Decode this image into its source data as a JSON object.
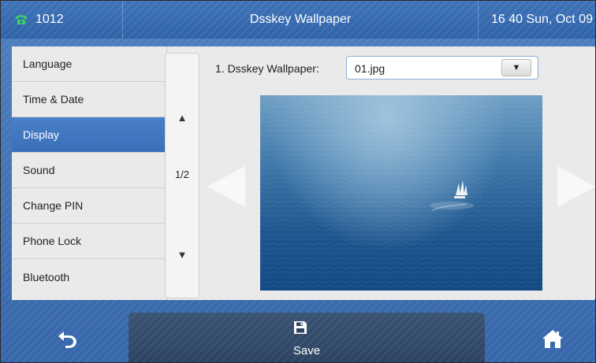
{
  "titlebar": {
    "account": "1012",
    "title": "Dsskey Wallpaper",
    "clock": "16 40 Sun, Oct 09"
  },
  "menu": {
    "items": [
      {
        "label": "Language"
      },
      {
        "label": "Time & Date"
      },
      {
        "label": "Display",
        "active": true
      },
      {
        "label": "Sound"
      },
      {
        "label": "Change PIN"
      },
      {
        "label": "Phone Lock"
      },
      {
        "label": "Bluetooth"
      }
    ],
    "page_indicator": "1/2"
  },
  "setting": {
    "label": "1. Dsskey Wallpaper:",
    "value": "01.jpg"
  },
  "softkeys": {
    "save_label": "Save"
  },
  "icons": {
    "account": "phone-icon",
    "back": "back-arrow-icon",
    "save": "floppy-disk-icon",
    "home": "home-icon",
    "scroll_up": "triangle-up-icon",
    "scroll_down": "triangle-down-icon",
    "dropdown": "triangle-down-icon",
    "prev": "triangle-left-icon",
    "next": "triangle-right-icon"
  },
  "colors": {
    "accent": "#3a6fb9",
    "titlebar": "#2f62a8",
    "softkey_active": "#2d4363",
    "panel": "#eaeaea",
    "phone_icon": "#3fd06a"
  }
}
